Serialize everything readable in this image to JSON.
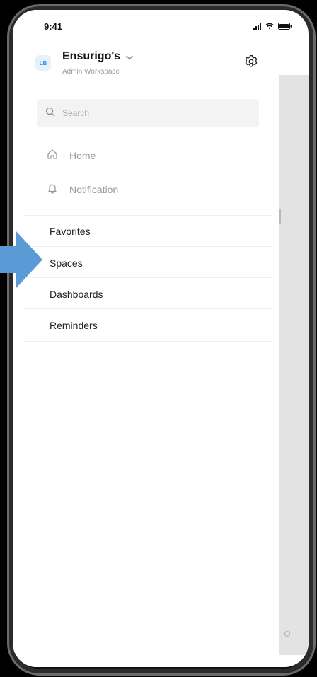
{
  "status_bar": {
    "time": "9:41"
  },
  "workspace": {
    "avatar_initials": "LB",
    "name": "Ensurigo's",
    "subtitle": "Admin Workspace"
  },
  "search": {
    "placeholder": "Search"
  },
  "nav": {
    "items": [
      {
        "label": "Home",
        "icon": "home-icon"
      },
      {
        "label": "Notification",
        "icon": "bell-icon"
      }
    ]
  },
  "sections": {
    "items": [
      {
        "label": "Favorites"
      },
      {
        "label": "Spaces"
      },
      {
        "label": "Dashboards"
      },
      {
        "label": "Reminders"
      }
    ]
  },
  "colors": {
    "accent": "#5b9bd5",
    "avatar_bg": "#e5f1fb",
    "avatar_fg": "#3a8ee0",
    "muted_text": "#9a9a9a",
    "search_bg": "#f3f3f3"
  }
}
